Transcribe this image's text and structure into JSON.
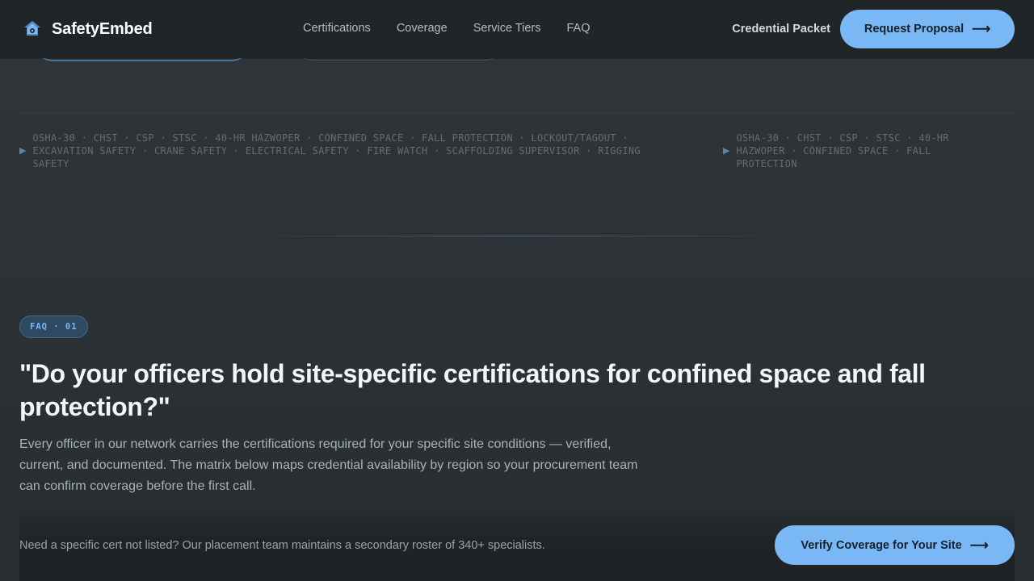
{
  "nav": {
    "brand": "SafetyEmbed",
    "logo_icon": "shield-home-icon",
    "links": [
      "Certifications",
      "Coverage",
      "Service Tiers",
      "FAQ"
    ],
    "secondary_link": "Credential Packet",
    "cta_label": "Request Proposal",
    "cta_icon": "arrow-right-icon"
  },
  "ticker": {
    "primary": "OSHA-30 · CHST · CSP · STSC · 40-HR HAZWOPER · CONFINED SPACE · FALL PROTECTION · LOCKOUT/TAGOUT · EXCAVATION SAFETY · CRANE SAFETY · ELECTRICAL SAFETY · FIRE WATCH · SCAFFOLDING SUPERVISOR · RIGGING SAFETY",
    "secondary": "OSHA-30 · CHST · CSP · STSC · 40-HR HAZWOPER · CONFINED SPACE · FALL PROTECTION",
    "marker_icon": "triangle-right-icon"
  },
  "faq": {
    "badge": "FAQ · 01",
    "question": "\"Do your officers hold site-specific certifications for confined space and fall protection?\"",
    "answer": "Every officer in our network carries the certifications required for your specific site conditions — verified, current, and documented. The matrix below maps credential availability by region so your procurement team can confirm coverage before the first call."
  },
  "footer_panel": {
    "note": "Need a specific cert not listed? Our placement team maintains a secondary roster of 340+ specialists.",
    "cta_label": "Verify Coverage for Your Site"
  },
  "colors": {
    "accent": "#7ab8f5",
    "background": "#2c3235",
    "nav_background": "#1f2426"
  }
}
